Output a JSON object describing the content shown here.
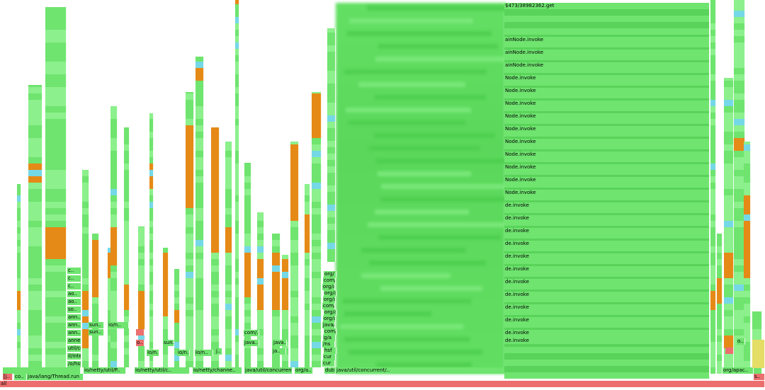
{
  "palette": {
    "green": "#6fe46f",
    "green_dark": "#59d359",
    "green_light": "#8cf08c",
    "orange": "#e58a16",
    "red": "#ec6e6e",
    "cyan": "#75d8e6",
    "yellow": "#e4dd66",
    "background": "#ffffff"
  },
  "root": {
    "label": "all"
  },
  "frames": {
    "left_root": "[j..",
    "co": "co..",
    "thread_run": "java/lang/Thread.run",
    "io_chan": "io/netty/channe..",
    "io_util": "io/netty/util/P..",
    "io_netty": "io/netty/util/c..",
    "util_conc": "java/util/concurrent/..",
    "orga": "org/a..",
    "dubb": "dubb",
    "left_stack": [
      "/o/hsf/io/netty/util/P..",
      "il/internal/ThreadE..",
      "util/concurrent/Singl..",
      "annel/nio/NioEventL..",
      "ann..",
      "ann..",
      "ann..",
      "so..",
      "ao..",
      "ao..",
      "c..",
      "c..",
      "c.."
    ],
    "main_bottom": "java/util/concurrent/..",
    "main_stack": [
      "cur",
      "cur",
      "hsf",
      "/ns",
      "g/a",
      "com/",
      "java/",
      "org/a",
      "org/a",
      "com/",
      "org/a",
      "org/a",
      "org/a",
      "com/",
      "org/"
    ],
    "right_invoke": "de.invoke",
    "right_invoke2": "Node.invoke",
    "right_invoke3": "ainNode.invoke",
    "top_get": "$473/38982362.get",
    "right_edge": "org/apac..",
    "right_s": "s..",
    "sun": "sun..",
    "io_n": "io/n..",
    "java_dots": "java..",
    "j_dots": "ja..",
    "com_dots": "com/..",
    "o_dots": "o..",
    "j_short": "j.."
  }
}
